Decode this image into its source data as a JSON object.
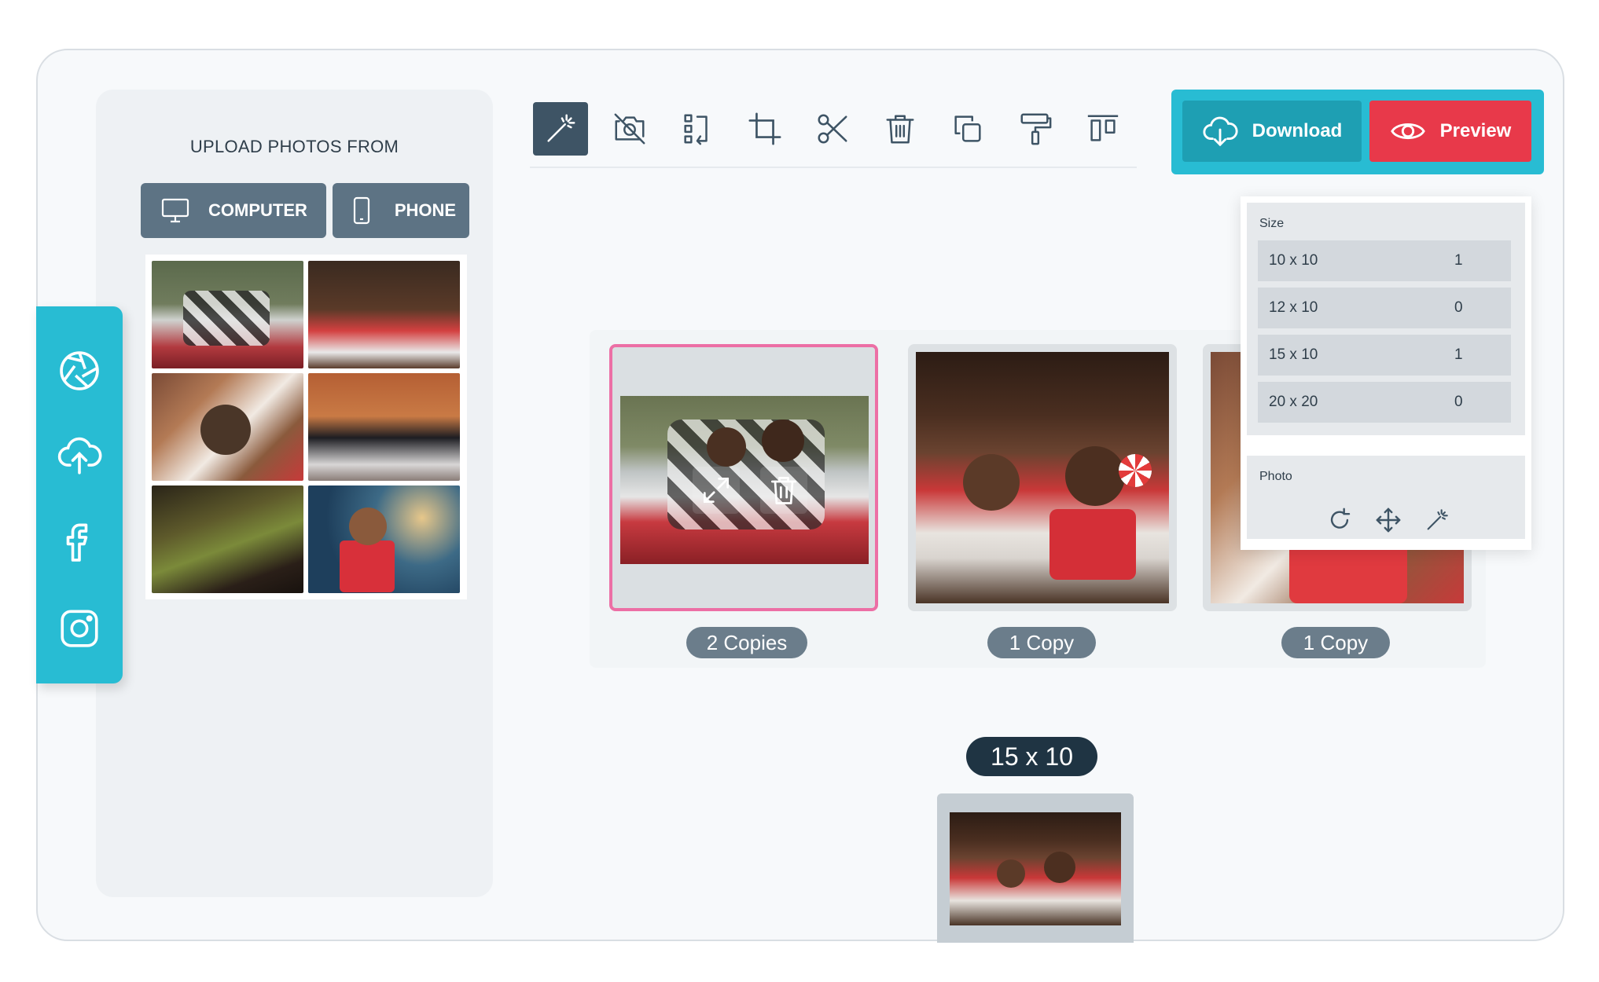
{
  "upload": {
    "title": "UPLOAD PHOTOS FROM",
    "computer_label": "COMPUTER",
    "phone_label": "PHONE"
  },
  "social": [
    "camera-shutter-icon",
    "cloud-upload-icon",
    "facebook-icon",
    "instagram-icon"
  ],
  "toolbar": [
    "magic-wand-icon",
    "no-photo-icon",
    "swap-icon",
    "crop-icon",
    "scissors-icon",
    "trash-icon",
    "duplicate-icon",
    "paint-roller-icon",
    "align-top-icon"
  ],
  "actions": {
    "download_label": "Download",
    "preview_label": "Preview"
  },
  "cards": [
    {
      "copies": "2 Copies"
    },
    {
      "copies": "1 Copy"
    },
    {
      "copies": "1 Copy"
    }
  ],
  "popup": {
    "size_label": "Size",
    "sizes": [
      {
        "name": "10 x 10",
        "count": "1"
      },
      {
        "name": "12 x 10",
        "count": "0"
      },
      {
        "name": "15 x 10",
        "count": "1"
      },
      {
        "name": "20 x 20",
        "count": "0"
      }
    ],
    "photo_label": "Photo"
  },
  "current_size": "15 x 10",
  "colors": {
    "accent": "#28bcd3",
    "download": "#1e9fb3",
    "preview": "#e8394a",
    "selected_border": "#ec6fa5",
    "dark": "#1f3443"
  }
}
